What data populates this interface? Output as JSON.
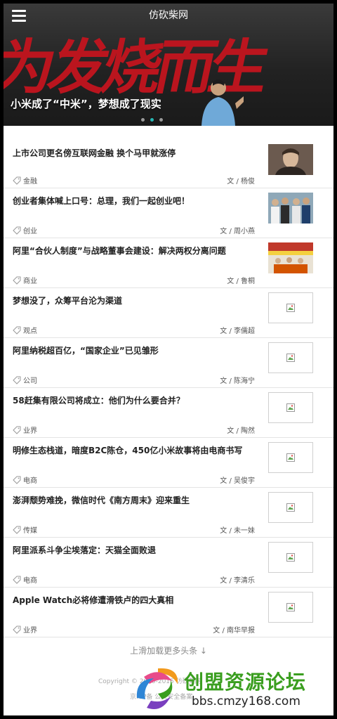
{
  "header": {
    "site_title": "仿砍柴网",
    "menu_icon": "hamburger-menu-icon"
  },
  "banner": {
    "art_text": "为发烧而生",
    "caption": "小米成了“中米”，梦想成了现实",
    "slides": 3,
    "active_slide": 2,
    "accent_color": "#c8141e",
    "dot_active_color": "#27b7b4"
  },
  "articles": [
    {
      "title": "上市公司更名傍互联网金融 换个马甲就涨停",
      "tag": "金融",
      "author": "文 / 杨俊",
      "thumb": "photo"
    },
    {
      "title": "创业者集体喊上口号：总理，我们一起创业吧！",
      "tag": "创业",
      "author": "文 / 周小燕",
      "thumb": "photo"
    },
    {
      "title": "阿里“合伙人制度”与战略董事会建设：解决两权分离问题",
      "tag": "商业",
      "author": "文 / 鲁桐",
      "thumb": "photo"
    },
    {
      "title": "梦想没了，众筹平台沦为渠道",
      "tag": "观点",
      "author": "文 / 李儒超",
      "thumb": "broken"
    },
    {
      "title": "阿里纳税超百亿，“国家企业”已见雏形",
      "tag": "公司",
      "author": "文 / 陈海宁",
      "thumb": "broken"
    },
    {
      "title": "58赶集有限公司将成立：他们为什么要合并？",
      "tag": "业界",
      "author": "文 / 陶然",
      "thumb": "broken"
    },
    {
      "title": "明修生态栈道，暗度B2C陈仓，450亿小米故事将由电商书写",
      "tag": "电商",
      "author": "文 / 吴俊宇",
      "thumb": "broken"
    },
    {
      "title": "澎湃颓势难挽，微信时代《南方周末》迎来重生",
      "tag": "传媒",
      "author": "文 / 未一妹",
      "thumb": "broken"
    },
    {
      "title": "阿里派系斗争尘埃落定：天猫全面败退",
      "tag": "电商",
      "author": "文 / 李清乐",
      "thumb": "broken"
    },
    {
      "title": "Apple Watch必将修遭滑铁卢的四大真相",
      "tag": "业界",
      "author": "文 / 南华早报",
      "thumb": "broken"
    }
  ],
  "footer": {
    "load_more": "上滑加载更多头条 ↓",
    "copyright": "Copyright © 2010-2015 仿砍柴网",
    "copyright_line2": "京ICP备 公共安全备案"
  },
  "watermark": {
    "text": "创盟资源论坛",
    "url": "bbs.cmzy168.com"
  }
}
